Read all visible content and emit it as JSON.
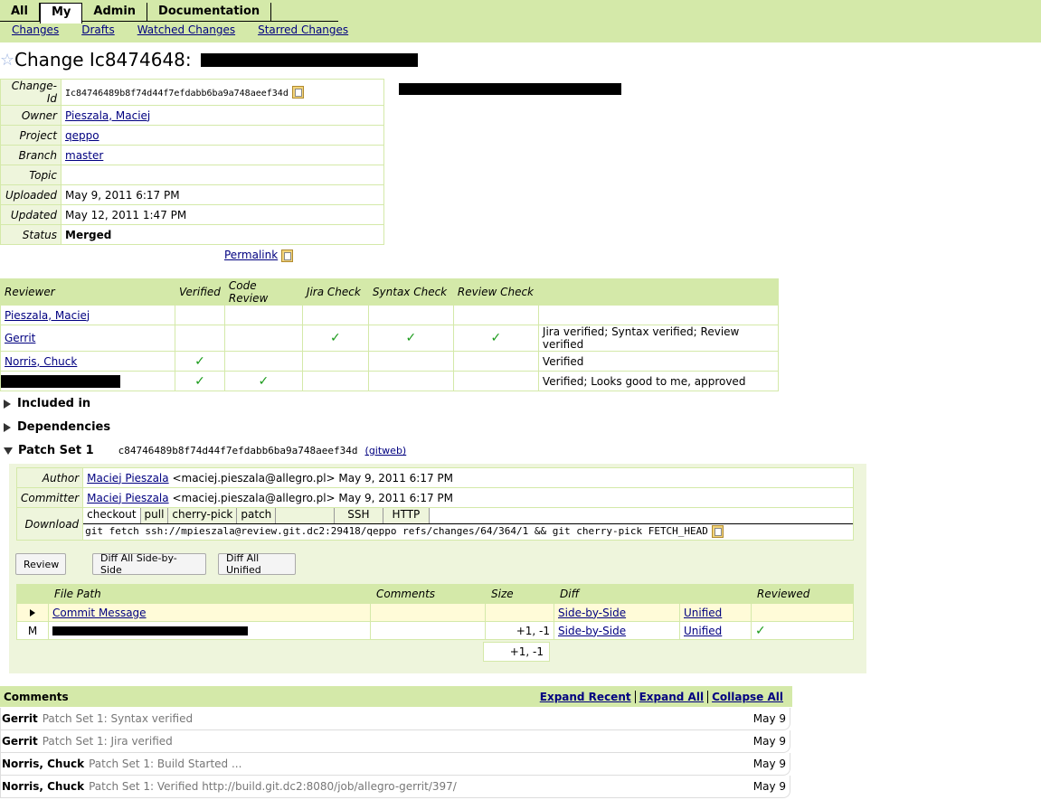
{
  "nav": {
    "tabs": [
      {
        "label": "All",
        "active": false
      },
      {
        "label": "My",
        "active": true
      },
      {
        "label": "Admin",
        "active": false
      },
      {
        "label": "Documentation",
        "active": false
      }
    ],
    "sub_links": [
      "Changes",
      "Drafts",
      "Watched Changes",
      "Starred Changes"
    ]
  },
  "title": {
    "prefix": "Change Ic8474648:",
    "subject_redacted": true
  },
  "info": {
    "change_id_label": "Change-Id",
    "change_id": "Ic84746489b8f74d44f7efdabb6ba9a748aeef34d",
    "owner_label": "Owner",
    "owner": "Pieszala, Maciej",
    "project_label": "Project",
    "project": "qeppo",
    "branch_label": "Branch",
    "branch": "master",
    "topic_label": "Topic",
    "topic": "",
    "uploaded_label": "Uploaded",
    "uploaded": "May 9, 2011 6:17 PM",
    "updated_label": "Updated",
    "updated": "May 12, 2011 1:47 PM",
    "status_label": "Status",
    "status": "Merged",
    "permalink": "Permalink"
  },
  "approvals": {
    "headers": [
      "Reviewer",
      "Verified",
      "Code Review",
      "Jira Check",
      "Syntax Check",
      "Review Check",
      ""
    ],
    "rows": [
      {
        "reviewer": "Pieszala, Maciej",
        "redacted": false,
        "verified": "",
        "code_review": "",
        "jira": "",
        "syntax": "",
        "review": "",
        "note": ""
      },
      {
        "reviewer": "Gerrit",
        "redacted": false,
        "verified": "",
        "code_review": "",
        "jira": "✓",
        "syntax": "✓",
        "review": "✓",
        "note": "Jira verified; Syntax verified; Review verified"
      },
      {
        "reviewer": "Norris, Chuck",
        "redacted": false,
        "verified": "✓",
        "code_review": "",
        "jira": "",
        "syntax": "",
        "review": "",
        "note": "Verified"
      },
      {
        "reviewer": "",
        "redacted": true,
        "verified": "✓",
        "code_review": "✓",
        "jira": "",
        "syntax": "",
        "review": "",
        "note": "Verified; Looks good to me, approved"
      }
    ]
  },
  "sections": {
    "included_in": "Included in",
    "dependencies": "Dependencies",
    "patch_set": "Patch Set 1",
    "patch_set_rev": "c84746489b8f74d44f7efdabb6ba9a748aeef34d",
    "gitweb": "(gitweb)"
  },
  "patch_set": {
    "author_label": "Author",
    "author_name": "Maciej Pieszala",
    "author_rest": "<maciej.pieszala@allegro.pl> May 9, 2011 6:17 PM",
    "committer_label": "Committer",
    "committer_name": "Maciej Pieszala",
    "committer_rest": "<maciej.pieszala@allegro.pl> May 9, 2011 6:17 PM",
    "download_label": "Download",
    "download_tabs": [
      "checkout",
      "pull",
      "cherry-pick",
      "patch"
    ],
    "protocol_tabs": [
      "SSH",
      "HTTP"
    ],
    "download_cmd": "git fetch ssh://mpieszala@review.git.dc2:29418/qeppo refs/changes/64/364/1 && git cherry-pick FETCH_HEAD"
  },
  "buttons": {
    "review": "Review",
    "diff_sbs": "Diff All Side-by-Side",
    "diff_unified": "Diff All Unified"
  },
  "files": {
    "headers": [
      "",
      "File Path",
      "Comments",
      "Size",
      "Diff",
      "",
      "Reviewed"
    ],
    "rows": [
      {
        "mark": "",
        "path": "Commit Message",
        "redacted": false,
        "comments": "",
        "size": "",
        "sbs": "Side-by-Side",
        "unified": "Unified",
        "reviewed": ""
      },
      {
        "mark": "M",
        "path": "",
        "redacted": true,
        "comments": "",
        "size": "+1, -1",
        "sbs": "Side-by-Side",
        "unified": "Unified",
        "reviewed": "✓"
      }
    ],
    "total_size": "+1, -1"
  },
  "comments": {
    "title": "Comments",
    "actions": [
      "Expand Recent",
      "Expand All",
      "Collapse All"
    ],
    "items": [
      {
        "author": "Gerrit",
        "message": "Patch Set 1: Syntax verified",
        "date": "May 9"
      },
      {
        "author": "Gerrit",
        "message": "Patch Set 1: Jira verified",
        "date": "May 9"
      },
      {
        "author": "Norris, Chuck",
        "message": "Patch Set 1: Build Started ...",
        "date": "May 9"
      },
      {
        "author": "Norris, Chuck",
        "message": "Patch Set 1: Verified http://build.git.dc2:8080/job/allegro-gerrit/397/",
        "date": "May 9"
      }
    ]
  },
  "colors": {
    "header_bg": "#d4e9a9",
    "label_bg": "#eef5dc",
    "link": "#000080",
    "check": "#1a9a1a"
  }
}
